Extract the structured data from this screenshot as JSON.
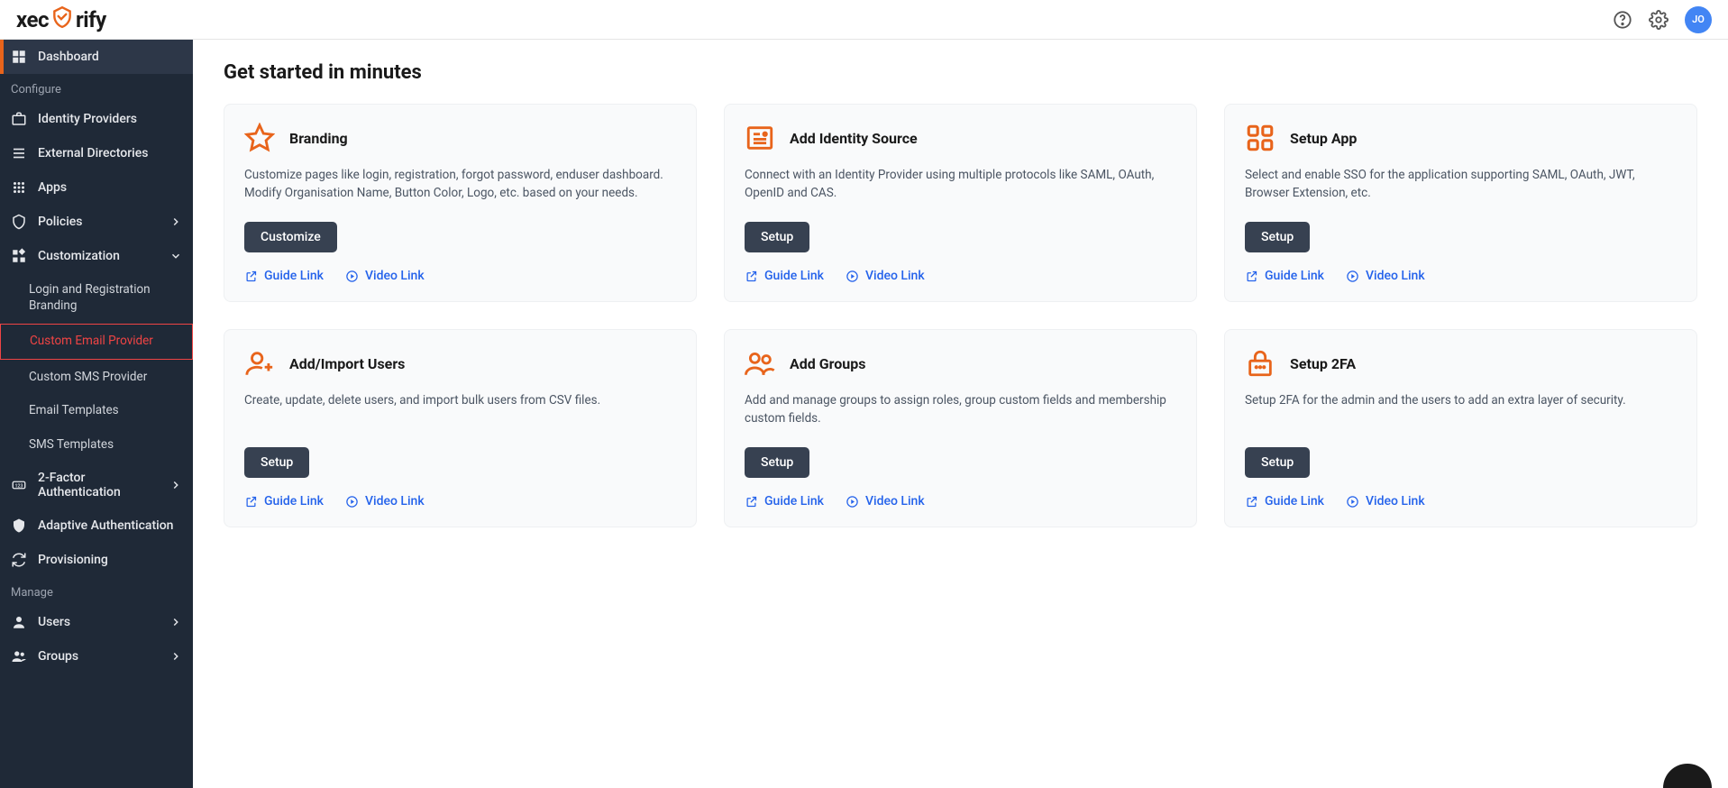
{
  "header": {
    "avatar": "JO"
  },
  "sidebar": {
    "dashboard": "Dashboard",
    "section_configure": "Configure",
    "identity_providers": "Identity Providers",
    "external_directories": "External Directories",
    "apps": "Apps",
    "policies": "Policies",
    "customization": "Customization",
    "sub_login_branding": "Login and Registration Branding",
    "sub_custom_email": "Custom Email Provider",
    "sub_custom_sms": "Custom SMS Provider",
    "sub_email_templates": "Email Templates",
    "sub_sms_templates": "SMS Templates",
    "two_factor": "2-Factor Authentication",
    "adaptive_auth": "Adaptive Authentication",
    "provisioning": "Provisioning",
    "section_manage": "Manage",
    "users": "Users",
    "groups": "Groups"
  },
  "main": {
    "title": "Get started in minutes",
    "guide_link": "Guide Link",
    "video_link": "Video Link",
    "cards": [
      {
        "title": "Branding",
        "desc": "Customize pages like login, registration, forgot password, enduser dashboard. Modify Organisation Name, Button Color, Logo, etc. based on your needs.",
        "btn": "Customize"
      },
      {
        "title": "Add Identity Source",
        "desc": "Connect with an Identity Provider using multiple protocols like SAML, OAuth, OpenID and CAS.",
        "btn": "Setup"
      },
      {
        "title": "Setup App",
        "desc": "Select and enable SSO for the application supporting SAML, OAuth, JWT, Browser Extension, etc.",
        "btn": "Setup"
      },
      {
        "title": "Add/Import Users",
        "desc": "Create, update, delete users, and import bulk users from CSV files.",
        "btn": "Setup"
      },
      {
        "title": "Add Groups",
        "desc": "Add and manage groups to assign roles, group custom fields and membership custom fields.",
        "btn": "Setup"
      },
      {
        "title": "Setup 2FA",
        "desc": "Setup 2FA for the admin and the users to add an extra layer of security.",
        "btn": "Setup"
      }
    ]
  }
}
